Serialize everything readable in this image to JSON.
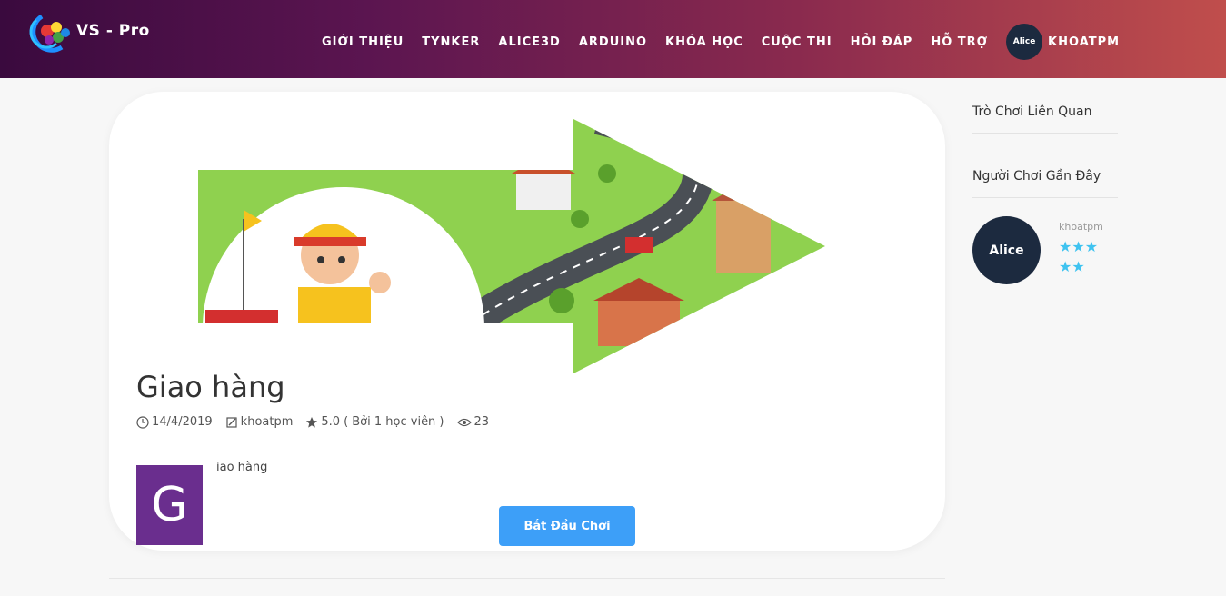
{
  "header": {
    "logo_text": "VS - Pro",
    "nav": [
      "GIỚI THIỆU",
      "TYNKER",
      "ALICE3D",
      "ARDUINO",
      "KHÓA HỌC",
      "CUỘC THI",
      "HỎI ĐÁP",
      "HỖ TRỢ"
    ],
    "user_name": "KHOATPM",
    "avatar_text": "Alice"
  },
  "game": {
    "title": "Giao hàng",
    "date": "14/4/2019",
    "author": "khoatpm",
    "rating": "5.0",
    "rating_note": "( Bởi 1 học viên )",
    "views": "23",
    "thumb_letter": "G",
    "description": "iao hàng",
    "play_label": "Bắt Đầu Chơi"
  },
  "sidebar": {
    "related_title": "Trò Chơi Liên Quan",
    "recent_title": "Người Chơi Gần Đây",
    "player": {
      "name": "khoatpm",
      "avatar_text": "Alice",
      "stars": 5
    }
  },
  "colors": {
    "accent": "#3d9ff8",
    "star": "#3fc3f0",
    "thumb": "#6a2e8e"
  }
}
